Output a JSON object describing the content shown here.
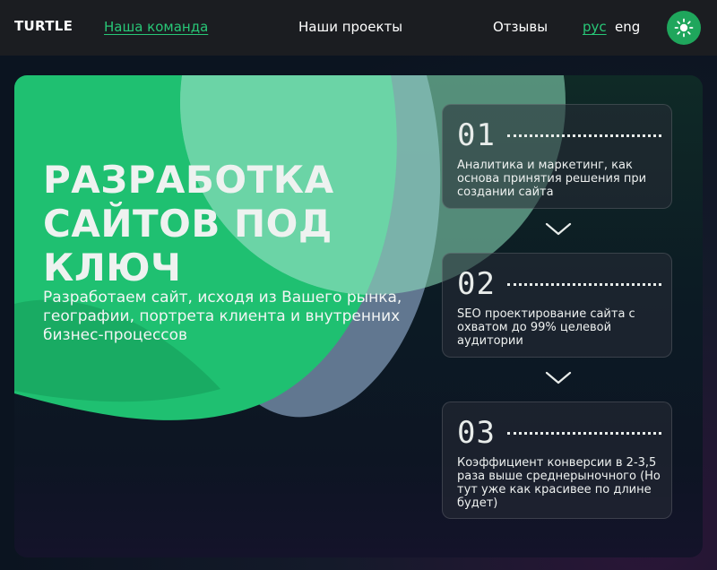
{
  "header": {
    "logo": "TURTLE",
    "nav": {
      "team": "Наша команда",
      "projects": "Наши проекты",
      "reviews": "Отзывы"
    },
    "languages": {
      "ru": "рус",
      "en": "eng",
      "active": "ru"
    },
    "theme_toggle_icon": "sun-icon"
  },
  "hero": {
    "title": "РАЗРАБОТКА САЙТОВ ПОД КЛЮЧ",
    "subtitle": "Разработаем сайт, исходя из Вашего рынка, географии, портрета клиента и внутренних бизнес-процессов"
  },
  "steps": [
    {
      "number": "01",
      "text": "Аналитика и маркетинг, как основа принятия решения при создании сайта"
    },
    {
      "number": "02",
      "text": "SEO проектирование сайта с охватом до 99% целевой аудитории"
    },
    {
      "number": "03",
      "text": "Коэффициент конверсии в 2-3,5 раза выше среднерыночного (Но тут уже как красивее по длине будет)"
    }
  ],
  "colors": {
    "accent": "#28c777",
    "header_bg": "#1b1d21",
    "hero_green": "#1fc071",
    "hero_mint": "#6dd4a8",
    "hero_slate": "#6a7f9a"
  },
  "icons": {
    "theme": "sun-icon",
    "step_arrow": "chevron-down-icon"
  }
}
